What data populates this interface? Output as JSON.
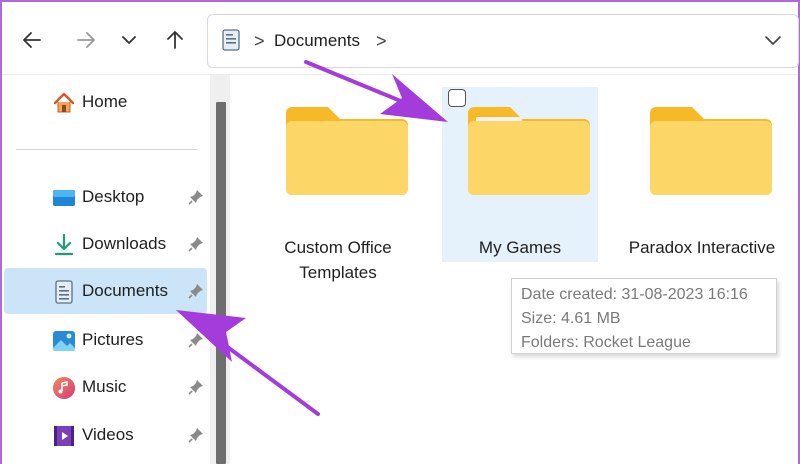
{
  "address_bar": {
    "crumb": "Documents",
    "separator": ">",
    "icons": [
      "document-icon",
      "chevron-right-icon",
      "chevron-down-icon"
    ]
  },
  "nav": {
    "icons": [
      "back-arrow-icon",
      "forward-arrow-icon",
      "recent-chevron-icon",
      "up-arrow-icon"
    ]
  },
  "sidebar": {
    "items": [
      {
        "label": "Home",
        "icon": "home-icon"
      },
      {
        "label": "Desktop",
        "icon": "desktop-icon",
        "pinned": true
      },
      {
        "label": "Downloads",
        "icon": "download-icon",
        "pinned": true
      },
      {
        "label": "Documents",
        "icon": "document-icon",
        "pinned": true,
        "selected": true
      },
      {
        "label": "Pictures",
        "icon": "pictures-icon",
        "pinned": true
      },
      {
        "label": "Music",
        "icon": "music-icon",
        "pinned": true
      },
      {
        "label": "Videos",
        "icon": "videos-icon",
        "pinned": true
      }
    ]
  },
  "folders": [
    {
      "label": "Custom Office Templates"
    },
    {
      "label": "My Games",
      "hovered": true
    },
    {
      "label": "Paradox Interactive"
    }
  ],
  "tooltip": {
    "date_created": "Date created: 31-08-2023 16:16",
    "size": "Size: 4.61 MB",
    "folders": "Folders: Rocket League"
  },
  "colors": {
    "selection": "#cce4f7",
    "hover": "#e5f1fb",
    "annotation_arrow": "#a43cdc",
    "folder_back": "#f7b928",
    "folder_front": "#fcd666"
  }
}
